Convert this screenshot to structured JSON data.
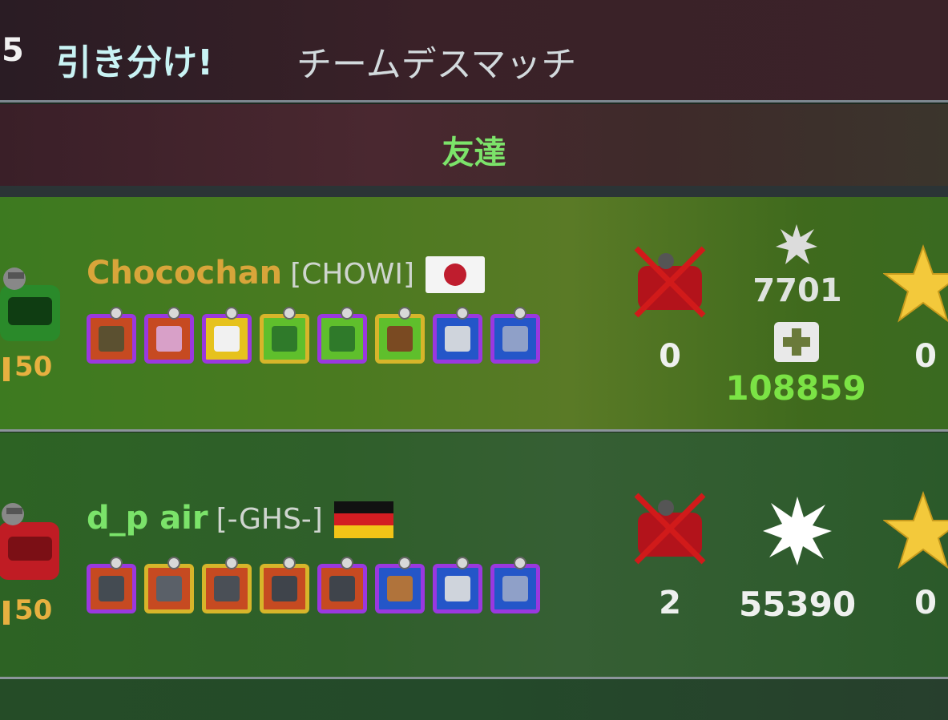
{
  "header": {
    "match_number": "5",
    "result": "引き分け!",
    "mode": "チームデスマッチ"
  },
  "team": {
    "label": "友達"
  },
  "players": [
    {
      "name": "Chocochan",
      "name_color": "#d8a53a",
      "clan": "[CHOWI]",
      "flag": "japan-flag",
      "level": "50",
      "kills": "0",
      "damage": "7701",
      "healing": "108859",
      "stars": "0",
      "slots": [
        {
          "frame": "#9a38df",
          "fill": "#c64a21",
          "icon": "mine-icon"
        },
        {
          "frame": "#9a38df",
          "fill": "#c64a21",
          "icon": "armor-icon"
        },
        {
          "frame": "#9a38df",
          "fill": "#e6c21d",
          "icon": "canister-icon"
        },
        {
          "frame": "#d7b52a",
          "fill": "#5fbf2c",
          "icon": "healer-gun-icon"
        },
        {
          "frame": "#9a38df",
          "fill": "#5fbf2c",
          "icon": "healer-gun-icon"
        },
        {
          "frame": "#d7b52a",
          "fill": "#5fbf2c",
          "icon": "repair-launcher-icon"
        },
        {
          "frame": "#9a38df",
          "fill": "#2456c8",
          "icon": "cannon-icon"
        },
        {
          "frame": "#9a38df",
          "fill": "#2456c8",
          "icon": "shield-icon"
        }
      ]
    },
    {
      "name": "d_p air",
      "name_color": "#7be36a",
      "clan": "[-GHS-]",
      "flag": "germany-flag",
      "level": "50",
      "kills": "2",
      "damage": "55390",
      "stars": "0",
      "slots": [
        {
          "frame": "#9a38df",
          "fill": "#c64a21",
          "icon": "cannon-icon"
        },
        {
          "frame": "#d7b52a",
          "fill": "#c64a21",
          "icon": "ram-icon"
        },
        {
          "frame": "#d7b52a",
          "fill": "#c64a21",
          "icon": "cannon-icon"
        },
        {
          "frame": "#d7b52a",
          "fill": "#c64a21",
          "icon": "missile-icon"
        },
        {
          "frame": "#9a38df",
          "fill": "#c64a21",
          "icon": "missile-icon"
        },
        {
          "frame": "#9a38df",
          "fill": "#2456c8",
          "icon": "crate-icon"
        },
        {
          "frame": "#9a38df",
          "fill": "#2456c8",
          "icon": "cannon-icon"
        },
        {
          "frame": "#9a38df",
          "fill": "#2456c8",
          "icon": "shield-icon"
        }
      ]
    }
  ]
}
